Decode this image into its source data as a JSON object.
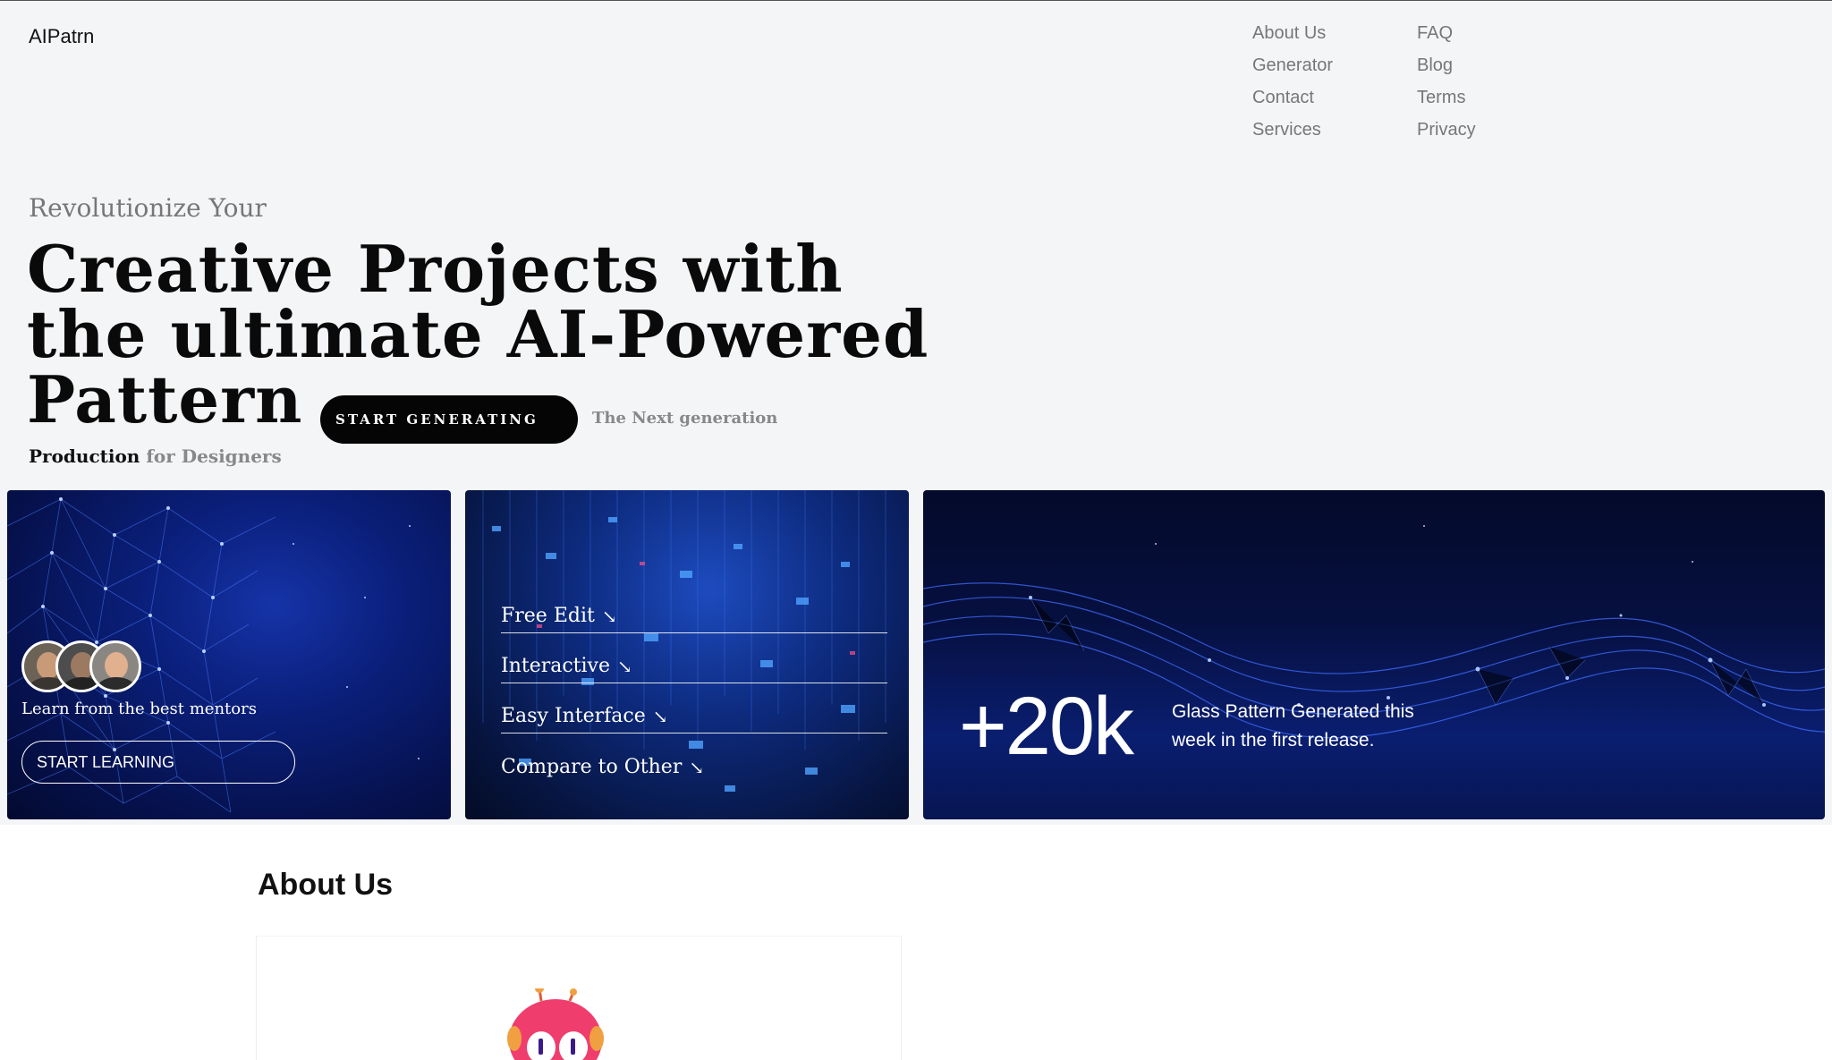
{
  "header": {
    "logo": "AIPatrn",
    "nav_col1": [
      "About Us",
      "Generator",
      "Contact",
      "Services"
    ],
    "nav_col2": [
      "FAQ",
      "Blog",
      "Terms",
      "Privacy"
    ]
  },
  "hero": {
    "eyebrow": "Revolutionize Your",
    "headline_lines": [
      "Creative Projects with",
      "the ultimate AI-Powered",
      "Pattern"
    ],
    "cta_label": "START GENERATING",
    "next_gen": "The Next generation",
    "tagline_strong": "Production",
    "tagline_muted": "for Designers"
  },
  "card_mentors": {
    "text": "Learn from the best mentors",
    "button_label": "START LEARNING"
  },
  "card_features": {
    "items": [
      "Free Edit",
      "Interactive",
      "Easy Interface",
      "Compare to Other"
    ],
    "arrow": "↘"
  },
  "card_stats": {
    "number": "+20k",
    "description": "Glass Pattern Generated this week in the first release."
  },
  "about": {
    "title": "About Us"
  },
  "colors": {
    "hero_bg": "#f4f5f7",
    "cta_bg": "#050505",
    "card_blue": "#0a1f7a"
  }
}
